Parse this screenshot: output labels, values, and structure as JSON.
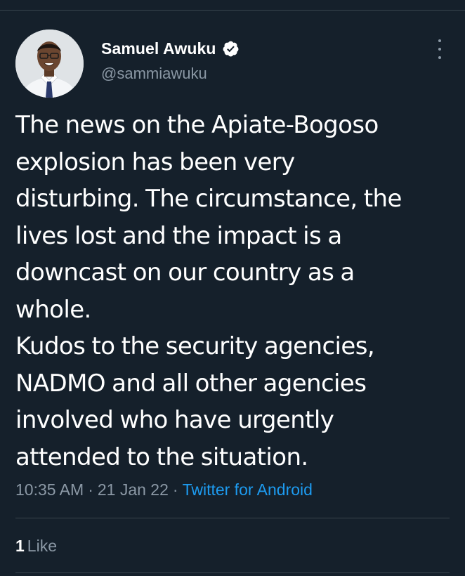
{
  "tweet": {
    "author": {
      "display_name": "Samuel Awuku",
      "handle": "@sammiawuku",
      "verified": true,
      "avatar_icon": "avatar-photo"
    },
    "text": "The news on the Apiate-Bogoso\nexplosion has been very\ndisturbing. The circumstance, the\nlives lost and the impact is a\ndowncast on our country as a\nwhole.\nKudos to the security agencies,\nNADMO and all other agencies\ninvolved who have urgently\nattended to the situation.",
    "time": "10:35 AM",
    "separator": "·",
    "date": "21 Jan 22",
    "source": "Twitter for Android",
    "likes": {
      "count": "1",
      "label": "Like"
    }
  },
  "icons": {
    "verified": "verified-badge-icon",
    "more": "more-options-icon"
  },
  "colors": {
    "background": "#15202b",
    "text_primary": "#ffffff",
    "text_secondary": "#8b98a5",
    "link": "#1d9bf0",
    "divider": "#38444d"
  }
}
